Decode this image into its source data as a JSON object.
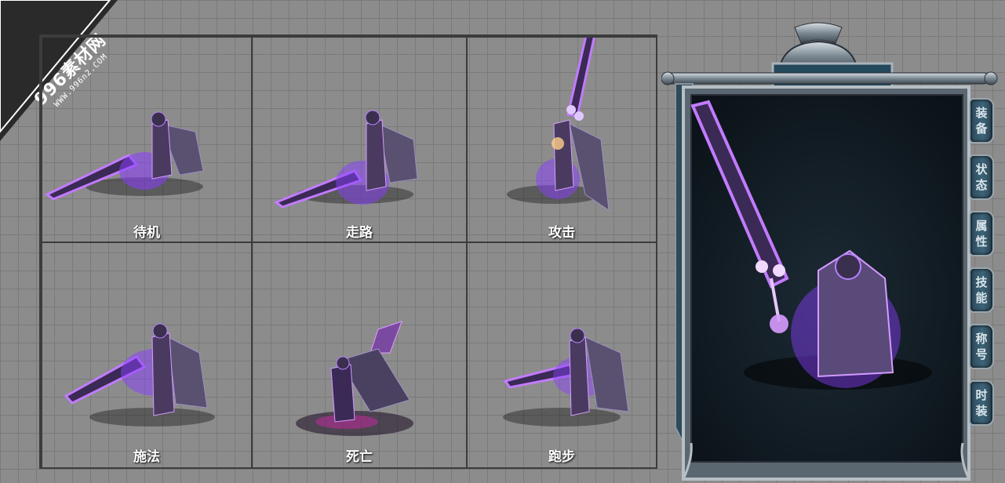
{
  "watermark": {
    "main": "996素材网",
    "sub": "WWW.996n2.COM"
  },
  "panels": [
    {
      "id": "idle",
      "label": "待机"
    },
    {
      "id": "walk",
      "label": "走路"
    },
    {
      "id": "attack",
      "label": "攻击"
    },
    {
      "id": "cast",
      "label": "施法"
    },
    {
      "id": "death",
      "label": "死亡"
    },
    {
      "id": "run",
      "label": "跑步"
    }
  ],
  "character_window": {
    "tabs": [
      {
        "c1": "装",
        "c2": "备"
      },
      {
        "c1": "状",
        "c2": "态"
      },
      {
        "c1": "属",
        "c2": "性"
      },
      {
        "c1": "技",
        "c2": "能"
      },
      {
        "c1": "称",
        "c2": "号"
      },
      {
        "c1": "时",
        "c2": "装"
      }
    ]
  },
  "colors": {
    "grid_bg": "#8c8c8c",
    "grid_line": "#7a7a7a",
    "panel_border": "#3c3c3c",
    "glow": "#b35cff",
    "window_bg": "#101a22",
    "tab": "#3d6478"
  }
}
